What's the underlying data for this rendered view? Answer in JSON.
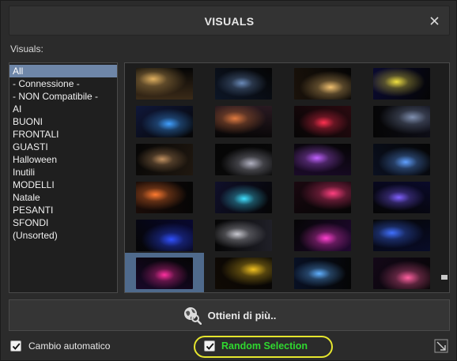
{
  "dialog": {
    "title": "VISUALS"
  },
  "labels": {
    "visuals": "Visuals:"
  },
  "categories": [
    {
      "label": "All",
      "selected": true
    },
    {
      "label": "- Connessione -"
    },
    {
      "label": "- NON Compatibile -"
    },
    {
      "label": "AI"
    },
    {
      "label": "BUONI"
    },
    {
      "label": "FRONTALI"
    },
    {
      "label": "GUASTI"
    },
    {
      "label": "Halloween"
    },
    {
      "label": "Inutili"
    },
    {
      "label": "MODELLI"
    },
    {
      "label": "Natale"
    },
    {
      "label": "PESANTI"
    },
    {
      "label": "SFONDI"
    },
    {
      "label": "(Unsorted)"
    }
  ],
  "thumbnails": [
    {
      "name": "vu-meter-amp",
      "bg": "#3a2a18",
      "accent": "#e0b060"
    },
    {
      "name": "lightning-storm",
      "bg": "#0d1626",
      "accent": "#6a8ab8"
    },
    {
      "name": "sparks-fireworks",
      "bg": "#1a120a",
      "accent": "#f0c070"
    },
    {
      "name": "pacman-arcade",
      "bg": "#0a0a30",
      "accent": "#f0e040"
    },
    {
      "name": "neon-dancer",
      "bg": "#10183a",
      "accent": "#40a0ff"
    },
    {
      "name": "sports-car-sunset",
      "bg": "#2a1a22",
      "accent": "#e07a40"
    },
    {
      "name": "red-stage-crowd",
      "bg": "#2a0a10",
      "accent": "#ff3050"
    },
    {
      "name": "dj-robot",
      "bg": "#0e0e18",
      "accent": "#8090b0"
    },
    {
      "name": "cassette-deck",
      "bg": "#201810",
      "accent": "#c09060"
    },
    {
      "name": "dancer-spotlight",
      "bg": "#0a0a0a",
      "accent": "#b0b0c0"
    },
    {
      "name": "neon-corridor",
      "bg": "#1a0a28",
      "accent": "#c060ff"
    },
    {
      "name": "disco-club-blue",
      "bg": "#0a1020",
      "accent": "#60a0ff"
    },
    {
      "name": "disco-ball-orange",
      "bg": "#1a0c08",
      "accent": "#ff7a30"
    },
    {
      "name": "dance-floor-lights",
      "bg": "#10102a",
      "accent": "#40e0ff"
    },
    {
      "name": "party-crowd-red",
      "bg": "#1a0810",
      "accent": "#ff4080"
    },
    {
      "name": "electric-arcs",
      "bg": "#0a0a2a",
      "accent": "#8060ff"
    },
    {
      "name": "blue-tunnel",
      "bg": "#080830",
      "accent": "#3050ff"
    },
    {
      "name": "astronaut-moon",
      "bg": "#202028",
      "accent": "#c8c8d0"
    },
    {
      "name": "neon-equalizer",
      "bg": "#200830",
      "accent": "#ff40d0"
    },
    {
      "name": "stage-performer",
      "bg": "#080c28",
      "accent": "#4070ff"
    },
    {
      "name": "neon-waves",
      "bg": "#180828",
      "accent": "#ff30a0",
      "selected": true
    },
    {
      "name": "warning-sign",
      "bg": "#100a04",
      "accent": "#f0c020"
    },
    {
      "name": "rock-concert-blue",
      "bg": "#081024",
      "accent": "#60b0ff"
    },
    {
      "name": "laser-rainbow",
      "bg": "#140818",
      "accent": "#ff60a0"
    }
  ],
  "buttons": {
    "get_more": "Ottieni di più.."
  },
  "options": {
    "auto_change_label": "Cambio automatico",
    "auto_change_checked": true,
    "random_label": "Random Selection",
    "random_checked": true
  },
  "colors": {
    "random_text": "#2fd82f",
    "highlight": "#e6e62e",
    "selection": "#6e86a8"
  }
}
